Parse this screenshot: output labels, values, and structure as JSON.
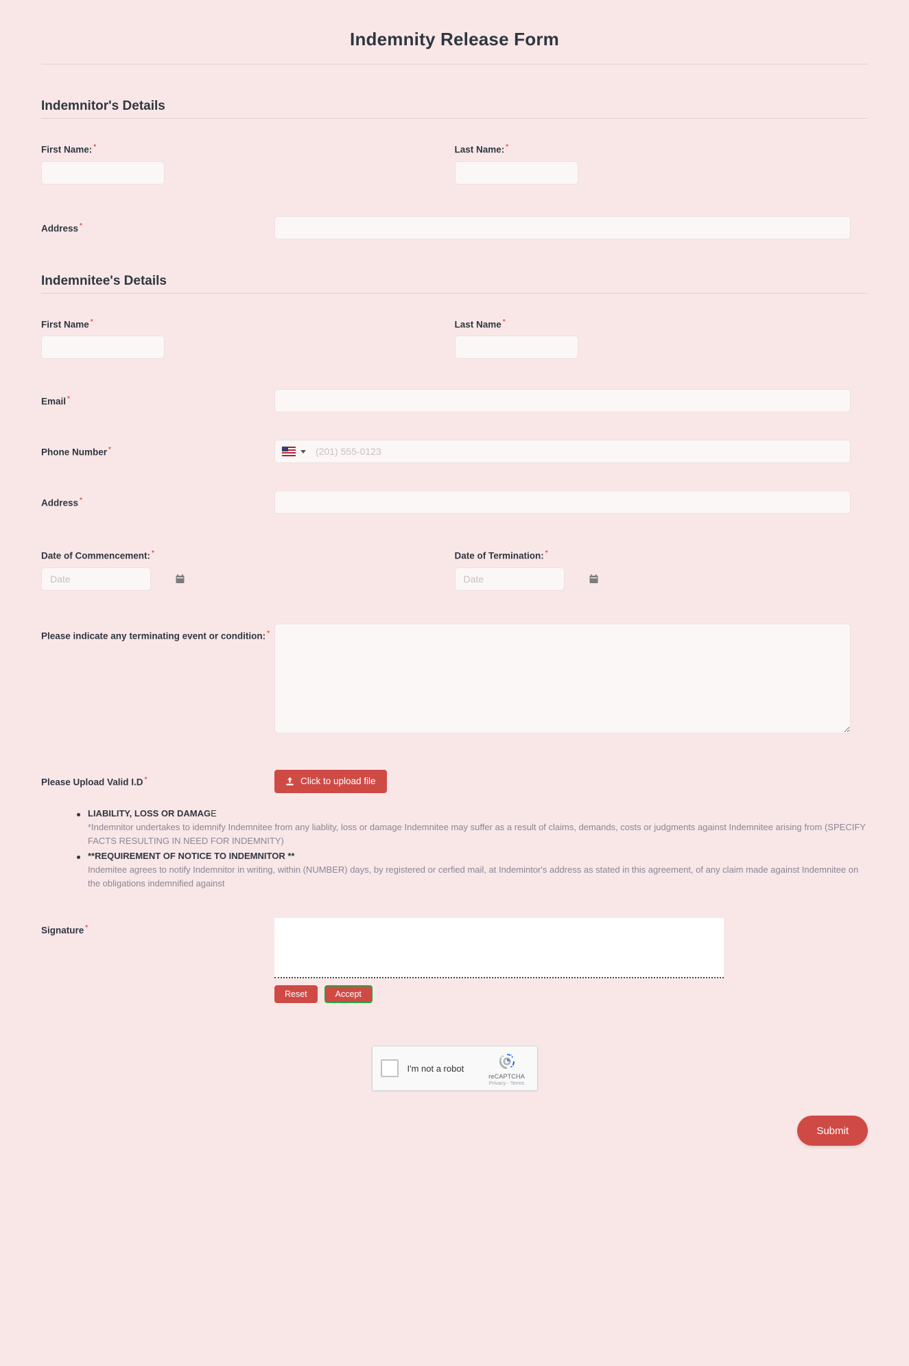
{
  "form": {
    "title": "Indemnity Release Form"
  },
  "sections": {
    "indemnitor": {
      "heading": "Indemnitor's Details",
      "first_name_label": "First Name:",
      "last_name_label": "Last Name:",
      "address_label": "Address",
      "first_name_value": "",
      "last_name_value": "",
      "address_value": ""
    },
    "indemnitee": {
      "heading": "Indemnitee's Details",
      "first_name_label": "First Name",
      "last_name_label": "Last Name",
      "email_label": "Email",
      "phone_label": "Phone Number",
      "address_label": "Address",
      "first_name_value": "",
      "last_name_value": "",
      "email_value": "",
      "address_value": "",
      "phone_value": "",
      "phone_placeholder": "(201) 555-0123",
      "phone_country": "United States",
      "date_commencement_label": "Date of Commencement:",
      "date_termination_label": "Date of Termination:",
      "date_placeholder": "Date",
      "date_commencement_value": "",
      "date_termination_value": "",
      "terminating_event_label": "Please indicate any terminating event or condition:",
      "terminating_event_value": "",
      "upload_label": "Please Upload Valid I.D",
      "upload_button": "Click to upload file"
    }
  },
  "terms": [
    {
      "heading_bold": "LIABILITY, LOSS OR DAMAG",
      "heading_light": "E",
      "body": "*Indemnitor undertakes to idemnify Indemnitee from any liablity, loss or damage Indemnitee may suffer as a result of claims, demands, costs or judgments against Indemnitee arising from (SPECIFY FACTS RESULTING IN NEED FOR INDEMNITY)"
    },
    {
      "heading_bold": "**REQUIREMENT OF NOTICE TO INDEMNITOR **",
      "heading_light": "",
      "body": "Indemitee agrees to notify Indemnitor in writing, within (NUMBER) days, by registered or cerfied mail, at Indemintor's address as stated in this agreement, of any claim made against Indemnitee on the obligations indemnified against"
    }
  ],
  "signature": {
    "label": "Signature",
    "reset_label": "Reset",
    "accept_label": "Accept"
  },
  "captcha": {
    "label": "I'm not a robot",
    "brand": "reCAPTCHA",
    "links": "Privacy - Terms"
  },
  "footer": {
    "submit_label": "Submit"
  },
  "required_marker": "*",
  "colors": {
    "background": "#f9e7e7",
    "accent": "#cf4a45",
    "required": "#e8554d",
    "accept_border": "#1faa3c",
    "text": "#2f3640",
    "muted": "#8a8596"
  }
}
